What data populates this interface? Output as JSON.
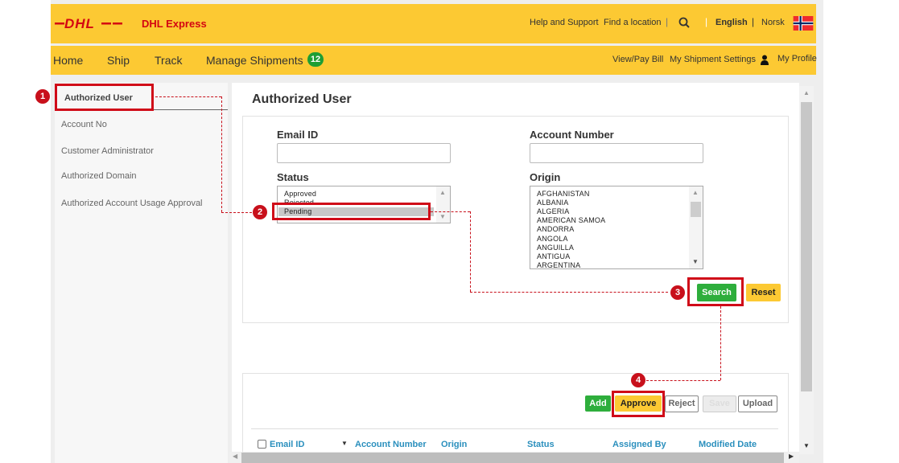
{
  "header": {
    "brand": "DHL Express",
    "logo_text": "DHL",
    "links": [
      "Help and Support",
      "Find a location"
    ],
    "lang_active": "English",
    "lang_alt": "Norsk",
    "flag": "norway-flag"
  },
  "nav": {
    "items": [
      "Home",
      "Ship",
      "Track",
      "Manage Shipments"
    ],
    "manage_badge": "12",
    "right_links": [
      "View/Pay Bill",
      "My Shipment Settings",
      "My Profile"
    ]
  },
  "sidebar": {
    "items": [
      {
        "label": "Authorized User",
        "active": true
      },
      {
        "label": "Account No"
      },
      {
        "label": "Customer Administrator"
      },
      {
        "label": "Authorized Domain"
      },
      {
        "label": "Authorized Account Usage Approval"
      }
    ]
  },
  "main": {
    "title": "Authorized User",
    "form": {
      "email_label": "Email ID",
      "email_value": "",
      "account_label": "Account Number",
      "account_value": "",
      "status_label": "Status",
      "status_options": [
        "Approved",
        "Rejected",
        "Pending"
      ],
      "status_selected": "Pending",
      "origin_label": "Origin",
      "origin_options": [
        "AFGHANISTAN",
        "ALBANIA",
        "ALGERIA",
        "AMERICAN SAMOA",
        "ANDORRA",
        "ANGOLA",
        "ANGUILLA",
        "ANTIGUA",
        "ARGENTINA"
      ],
      "search_label": "Search",
      "reset_label": "Reset"
    },
    "actions": {
      "add": "Add",
      "approve": "Approve",
      "reject": "Reject",
      "disabled": "Save",
      "upload": "Upload"
    },
    "table": {
      "columns": [
        "Email ID",
        "Account Number",
        "Origin",
        "Status",
        "Assigned By",
        "Modified Date"
      ]
    }
  },
  "annotations": {
    "steps": [
      "1",
      "2",
      "3",
      "4"
    ],
    "color": "#c8101b"
  },
  "colors": {
    "dhl_yellow": "#fcc933",
    "dhl_red": "#d40511",
    "green": "#2eae3c",
    "link_blue": "#2a8fbd"
  }
}
